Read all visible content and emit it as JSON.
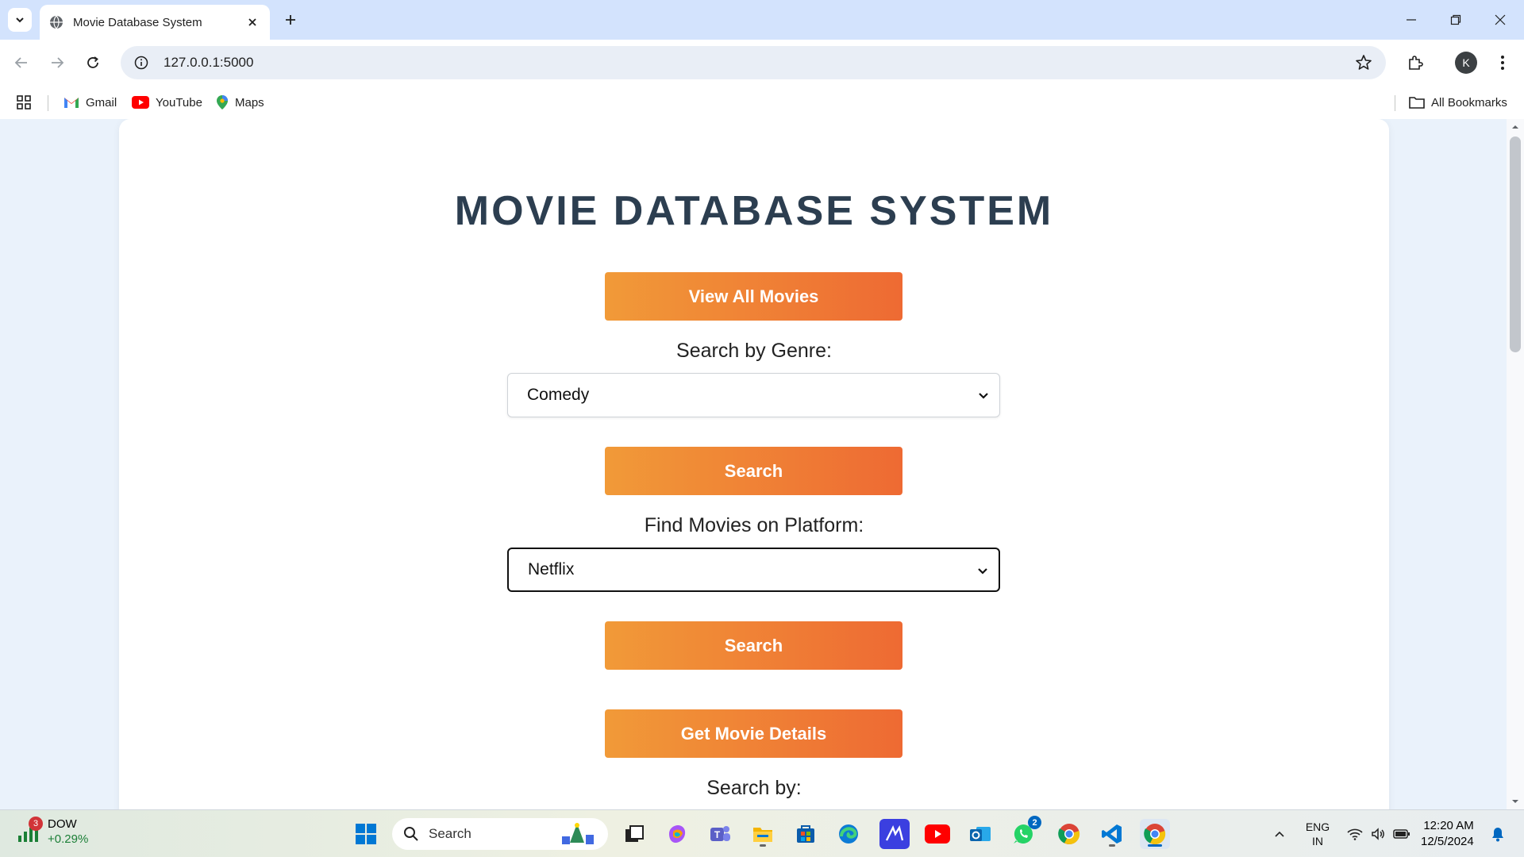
{
  "browser": {
    "tab_title": "Movie Database System",
    "url": "127.0.0.1:5000",
    "avatar_letter": "K",
    "bookmarks": [
      "Gmail",
      "YouTube",
      "Maps"
    ],
    "all_bookmarks": "All Bookmarks"
  },
  "page": {
    "title": "MOVIE DATABASE SYSTEM",
    "view_all_label": "View All Movies",
    "genre_label": "Search by Genre:",
    "genre_selected": "Comedy",
    "genre_search_label": "Search",
    "platform_label": "Find Movies on Platform:",
    "platform_selected": "Netflix",
    "platform_search_label": "Search",
    "details_label": "Get Movie Details",
    "search_by_label": "Search by:"
  },
  "taskbar": {
    "weather_badge": "3",
    "stock_name": "DOW",
    "stock_change": "+0.29%",
    "search_placeholder": "Search",
    "whatsapp_badge": "2",
    "lang_top": "ENG",
    "lang_bottom": "IN",
    "time": "12:20 AM",
    "date": "12/5/2024"
  },
  "colors": {
    "button_gradient_start": "#f19a38",
    "button_gradient_end": "#ee6a33",
    "title_color": "#2c3e50",
    "tabstrip": "#d3e3fd"
  }
}
